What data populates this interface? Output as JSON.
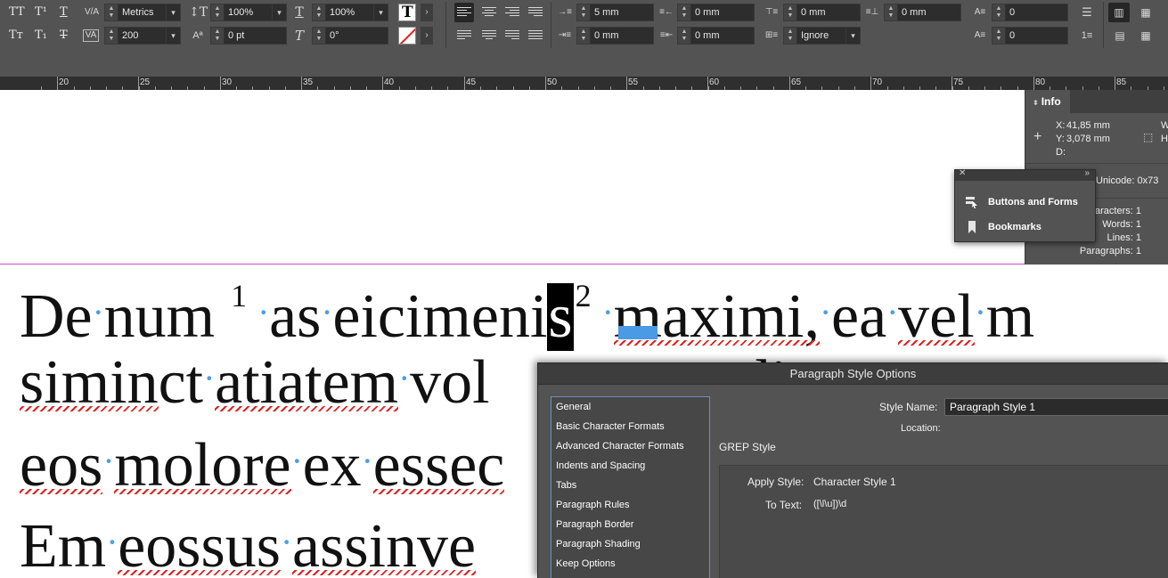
{
  "controlbar": {
    "char_glyphs": {
      "all_caps": "TT",
      "superscript": "T¹",
      "underline": "T",
      "small_caps": "Tт",
      "subscript": "T₁",
      "strikethrough": "T"
    },
    "kerning_value": "Metrics",
    "tracking_value": "200",
    "leading_value": "100%",
    "horizontal_scale_value": "100%",
    "baseline_shift_value": "0 pt",
    "skew_value": "0°",
    "left_indent": "5 mm",
    "first_line_indent": "0 mm",
    "right_indent": "0 mm",
    "last_line_indent": "0 mm",
    "space_before": "0 mm",
    "space_after": "0 mm",
    "align_to_grid": "Ignore",
    "drop_cap_lines": "0",
    "drop_cap_chars": "0"
  },
  "ruler": {
    "labels": [
      "20",
      "25",
      "30",
      "35",
      "40",
      "45",
      "50",
      "55",
      "60",
      "65",
      "70",
      "75",
      "80",
      "85"
    ]
  },
  "document": {
    "line1": {
      "w1": "De",
      "w2": "num",
      "sup1": "1",
      "w3": "as",
      "w4a": "eicimeni",
      "w4sel": "s",
      "sup2": "2",
      "w5": "maximi,",
      "w6": "ea",
      "w7": "vel",
      "w8": "m"
    },
    "line2": {
      "w1": "simin",
      "w1b": "ct",
      "w2": "atiatem",
      "w3": "vol",
      "tail": "dit"
    },
    "line3": {
      "w1": "eos",
      "w2": "molore",
      "w3": "ex",
      "w4": "essec"
    },
    "line4": {
      "w1": "Em",
      "w2": "eossus",
      "w3": "assinve"
    }
  },
  "info_panel": {
    "tab_label": "Info",
    "x_label": "X:",
    "x_value": "41,85 mm",
    "y_label": "Y:",
    "y_value": "3,078 mm",
    "d_label": "D:",
    "w_label": "W",
    "h_label": "H",
    "unicode": "Unicode: 0x73",
    "characters": "aracters: 1",
    "words": "Words: 1",
    "lines": "Lines: 1",
    "paragraphs": "Paragraphs: 1"
  },
  "float_panel": {
    "items": [
      {
        "label": "Buttons and Forms",
        "icon": "buttons-forms-icon"
      },
      {
        "label": "Bookmarks",
        "icon": "bookmark-icon"
      }
    ]
  },
  "dialog": {
    "title": "Paragraph Style Options",
    "categories": [
      "General",
      "Basic Character Formats",
      "Advanced Character Formats",
      "Indents and Spacing",
      "Tabs",
      "Paragraph Rules",
      "Paragraph Border",
      "Paragraph Shading",
      "Keep Options"
    ],
    "style_name_label": "Style Name:",
    "style_name_value": "Paragraph Style 1",
    "location_label": "Location:",
    "section_title": "GREP Style",
    "apply_style_label": "Apply Style:",
    "apply_style_value": "Character Style 1",
    "to_text_label": "To Text:",
    "to_text_value": "([\\l\\u])\\d"
  }
}
